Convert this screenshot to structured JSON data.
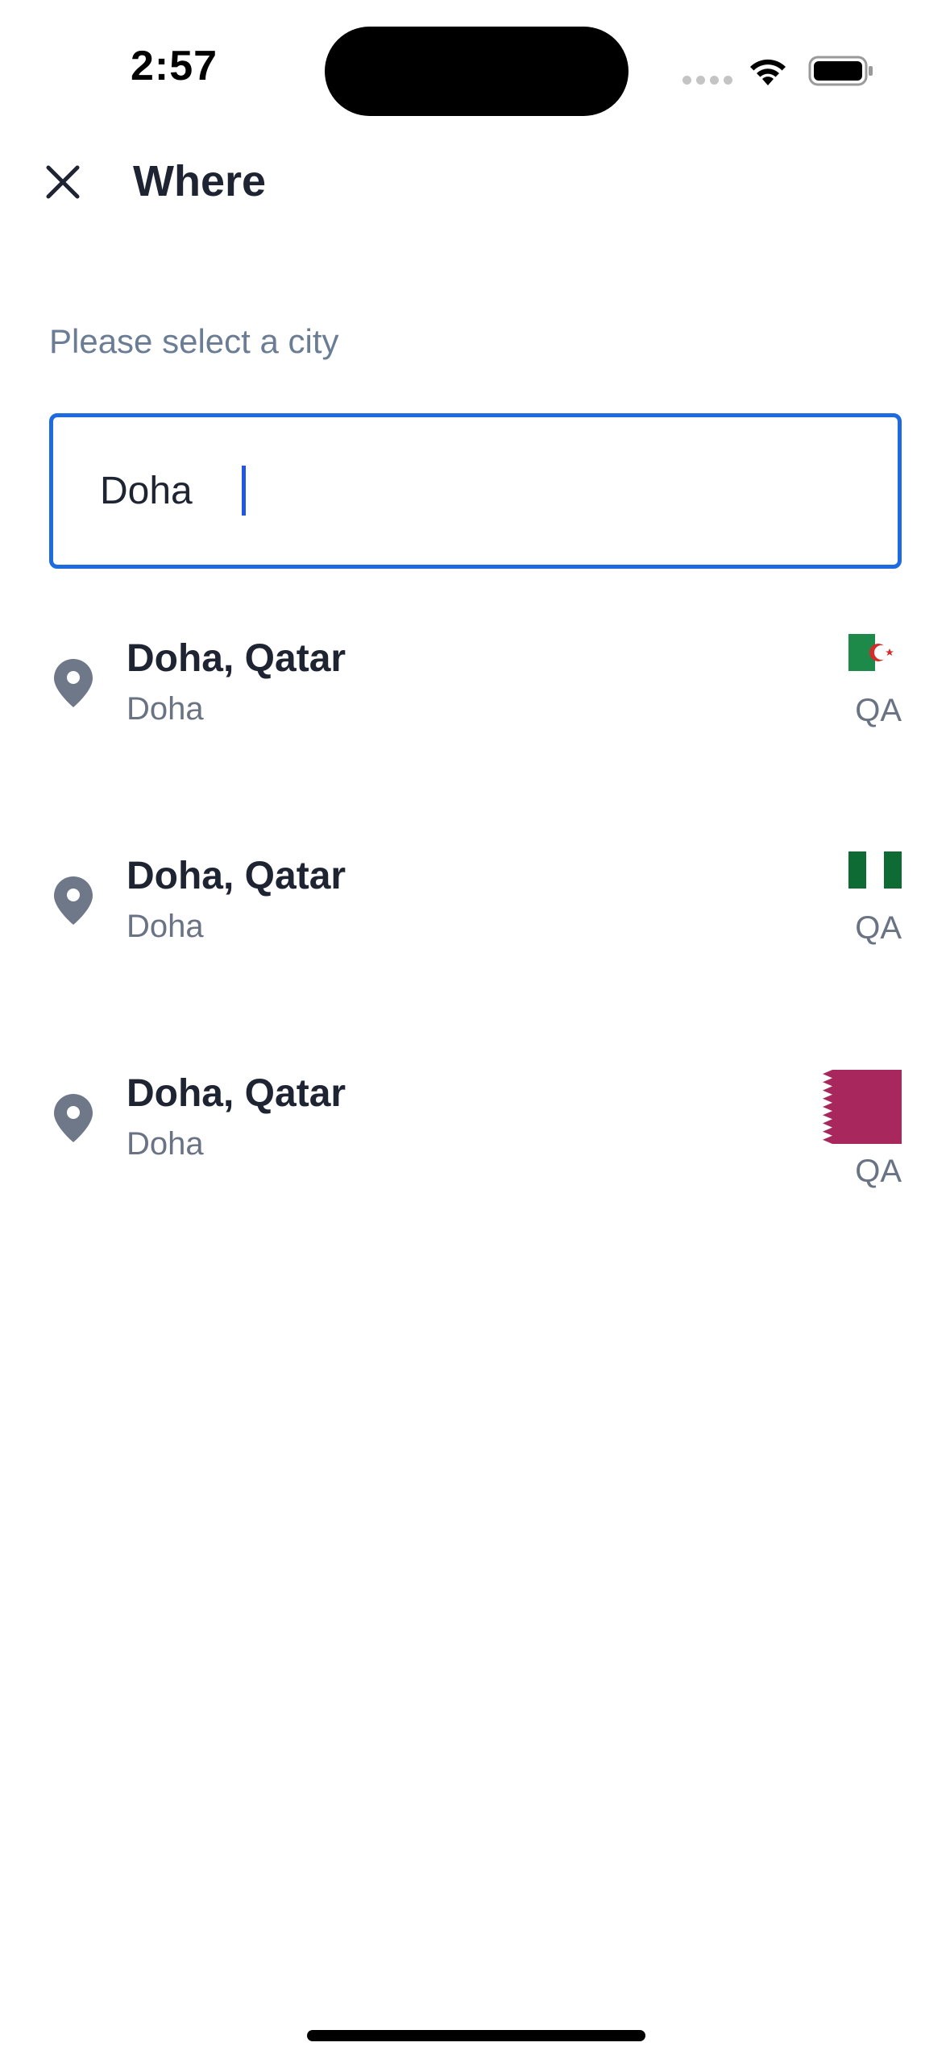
{
  "status_bar": {
    "time": "2:57"
  },
  "header": {
    "title": "Where",
    "close_icon": "close-icon"
  },
  "prompt": "Please select a city",
  "search": {
    "value": "Doha",
    "placeholder": ""
  },
  "results": [
    {
      "title": "Doha, Qatar",
      "subtitle": "Doha",
      "country_code": "QA",
      "flag_icon": "algeria-flag-icon"
    },
    {
      "title": "Doha, Qatar",
      "subtitle": "Doha",
      "country_code": "QA",
      "flag_icon": "nigeria-flag-icon"
    },
    {
      "title": "Doha, Qatar",
      "subtitle": "Doha",
      "country_code": "QA",
      "flag_icon": "qatar-flag-icon"
    }
  ],
  "colors": {
    "accent": "#1e6be0",
    "title_text": "#1f2433",
    "secondary_text": "#6a7384",
    "prompt_text": "#6a7d95",
    "pin": "#6e7889",
    "qatar_maroon": "#a8275d"
  }
}
